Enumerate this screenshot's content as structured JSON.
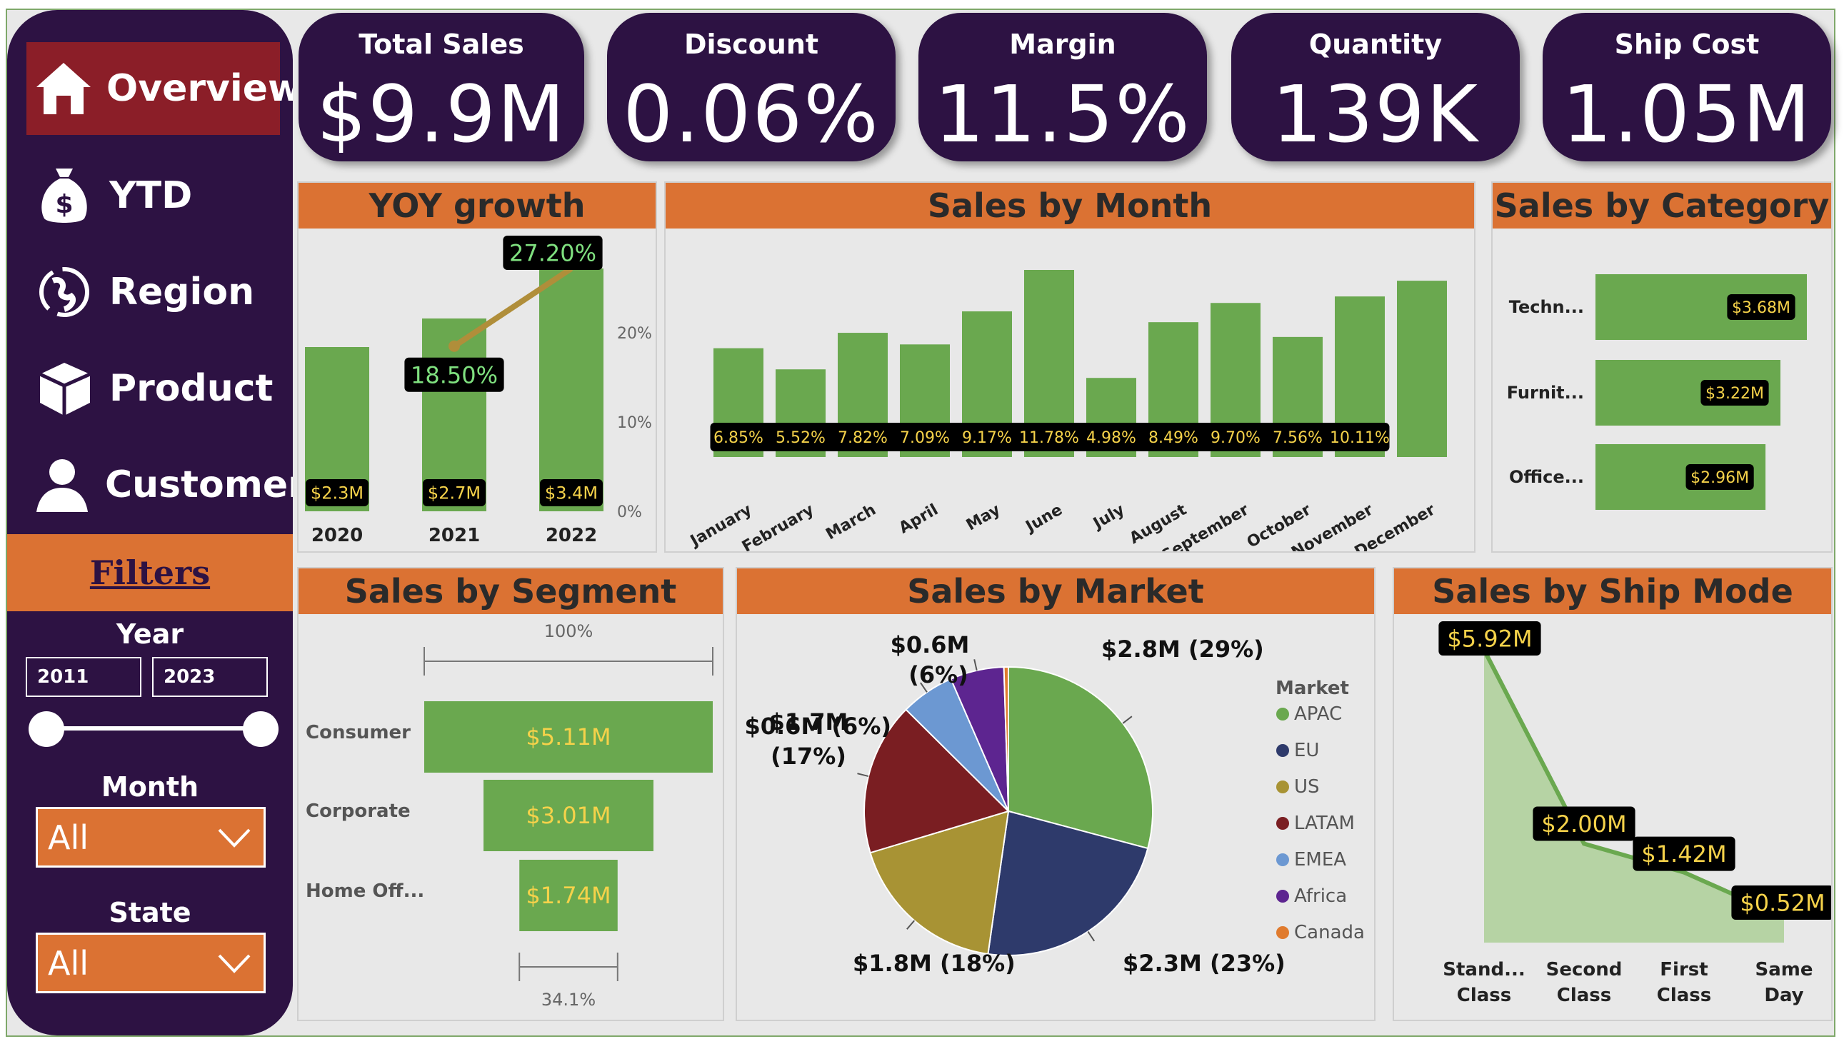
{
  "nav": {
    "items": [
      {
        "label": "Overview"
      },
      {
        "label": "YTD"
      },
      {
        "label": "Region"
      },
      {
        "label": "Product"
      },
      {
        "label": "Customer"
      }
    ]
  },
  "filters": {
    "title": "Filters",
    "year_label": "Year",
    "year_from": "2011",
    "year_to": "2023",
    "month_label": "Month",
    "month_value": "All",
    "state_label": "State",
    "state_value": "All"
  },
  "kpis": [
    {
      "title": "Total Sales",
      "value": "$9.9M"
    },
    {
      "title": "Discount",
      "value": "0.06%"
    },
    {
      "title": "Margin",
      "value": "11.5%"
    },
    {
      "title": "Quantity",
      "value": "139K"
    },
    {
      "title": "Ship Cost",
      "value": "1.05M"
    }
  ],
  "colors": {
    "sidebar": "#2d1243",
    "active_nav": "#8b1e28",
    "header_orange": "#db7233",
    "bar_green": "#6aa84f",
    "panel_bg": "#e8e8e8"
  },
  "chart_data": [
    {
      "id": "yoy",
      "title": "YOY growth",
      "type": "bar",
      "categories": [
        "2020",
        "2021",
        "2022"
      ],
      "values": [
        2.3,
        2.7,
        3.4
      ],
      "value_labels": [
        "$2.3M",
        "$2.7M",
        "$3.4M"
      ],
      "growth_line": {
        "x": [
          "2021",
          "2022"
        ],
        "values": [
          18.5,
          27.2
        ],
        "labels": [
          "18.50%",
          "27.20%"
        ]
      },
      "y2_ticks": [
        "0%",
        "10%",
        "20%"
      ],
      "y2lim": [
        0,
        27.2
      ]
    },
    {
      "id": "month",
      "title": "Sales by Month",
      "type": "bar",
      "categories": [
        "January",
        "February",
        "March",
        "April",
        "May",
        "June",
        "July",
        "August",
        "September",
        "October",
        "November",
        "December"
      ],
      "values": [
        6.85,
        5.52,
        7.82,
        7.09,
        9.17,
        11.78,
        4.98,
        8.49,
        9.7,
        7.56,
        10.11,
        11.1
      ],
      "value_labels": [
        "6.85%",
        "5.52%",
        "7.82%",
        "7.09%",
        "9.17%",
        "11.78%",
        "4.98%",
        "8.49%",
        "9.70%",
        "7.56%",
        "10.11%"
      ]
    },
    {
      "id": "category",
      "title": "Sales by Category",
      "type": "bar",
      "orientation": "horizontal",
      "categories": [
        "Techn...",
        "Furnit...",
        "Office..."
      ],
      "values": [
        3.68,
        3.22,
        2.96
      ],
      "value_labels": [
        "$3.68M",
        "$3.22M",
        "$2.96M"
      ]
    },
    {
      "id": "segment",
      "title": "Sales by Segment",
      "type": "bar",
      "orientation": "funnel",
      "categories": [
        "Consumer",
        "Corporate",
        "Home Off..."
      ],
      "values": [
        5.11,
        3.01,
        1.74
      ],
      "value_labels": [
        "$5.11M",
        "$3.01M",
        "$1.74M"
      ],
      "top_label": "100%",
      "bottom_label": "34.1%"
    },
    {
      "id": "market",
      "title": "Sales by Market",
      "type": "pie",
      "legend_title": "Market",
      "legend_position": "right",
      "slices": [
        {
          "name": "APAC",
          "value": 29,
          "color": "#6aa84f",
          "label": "$2.8M (29%)"
        },
        {
          "name": "EU",
          "value": 23,
          "color": "#2e3a6b",
          "label": "$2.3M (23%)"
        },
        {
          "name": "US",
          "value": 18,
          "color": "#a89334",
          "label": "$1.8M (18%)"
        },
        {
          "name": "LATAM",
          "value": 17,
          "color": "#7a1e22",
          "label": "$1.7M (17%)"
        },
        {
          "name": "EMEA",
          "value": 6,
          "color": "#6c98d2",
          "label": "$0.6M (6%)"
        },
        {
          "name": "Africa",
          "value": 6,
          "color": "#5d2590",
          "label": "$0.6M (6%)"
        },
        {
          "name": "Canada",
          "value": 0.5,
          "color": "#e07b2e",
          "label": ""
        }
      ]
    },
    {
      "id": "shipmode",
      "title": "Sales by Ship Mode",
      "type": "area",
      "categories": [
        "Stand... Class",
        "Second Class",
        "First Class",
        "Same Day"
      ],
      "values": [
        5.92,
        2.0,
        1.42,
        0.52
      ],
      "value_labels": [
        "$5.92M",
        "$2.00M",
        "$1.42M",
        "$0.52M"
      ]
    }
  ]
}
